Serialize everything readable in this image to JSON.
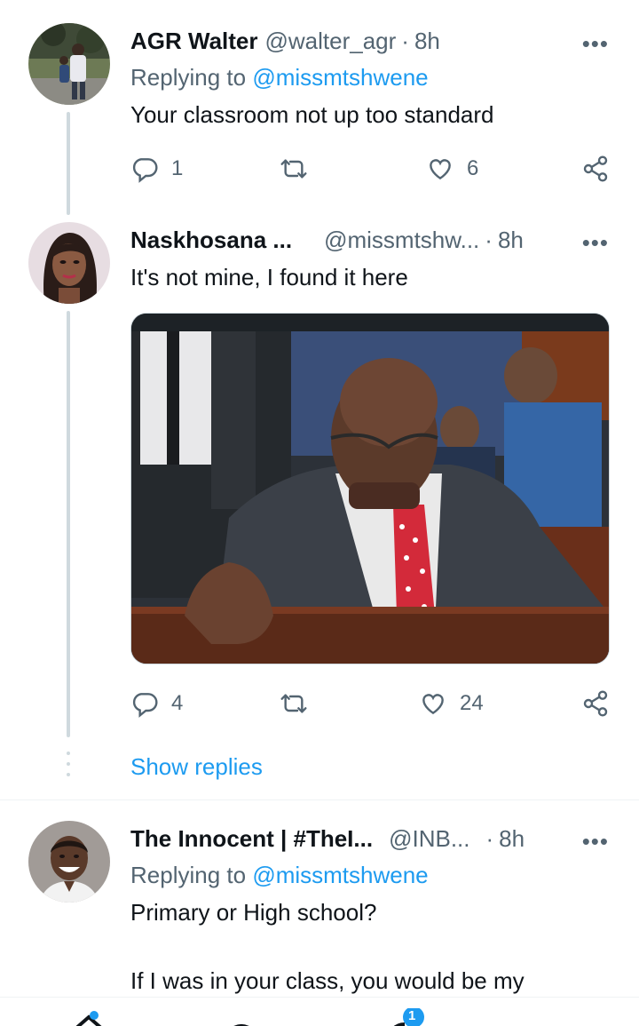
{
  "tweets": [
    {
      "name": "AGR Walter",
      "handle": "@walter_agr",
      "dot": "·",
      "time": "8h",
      "replying_prefix": "Replying to",
      "replying_to": "@missmtshwene",
      "text": "Your classroom not up too standard",
      "replies": "1",
      "retweets": "",
      "likes": "6"
    },
    {
      "name": "Naskhosana ...",
      "handle": "@missmtshw...",
      "dot": "·",
      "time": "8h",
      "text": "It's not mine, I found it here",
      "replies": "4",
      "retweets": "",
      "likes": "24"
    },
    {
      "name": "The Innocent | #TheI...",
      "handle": "@INB...",
      "dot": "·",
      "time": "8h",
      "replying_prefix": "Replying to",
      "replying_to": "@missmtshwene",
      "text_line1": "Primary or High school?",
      "text_line2": "If I was in your class, you would be my"
    }
  ],
  "show_replies": "Show replies",
  "more_label": "•••",
  "notification_badge": "1",
  "colors": {
    "accent": "#1d9bf0",
    "muted": "#536471",
    "line": "#cfd9de"
  },
  "icons": [
    "reply-icon",
    "retweet-icon",
    "like-icon",
    "share-icon",
    "more-icon"
  ]
}
